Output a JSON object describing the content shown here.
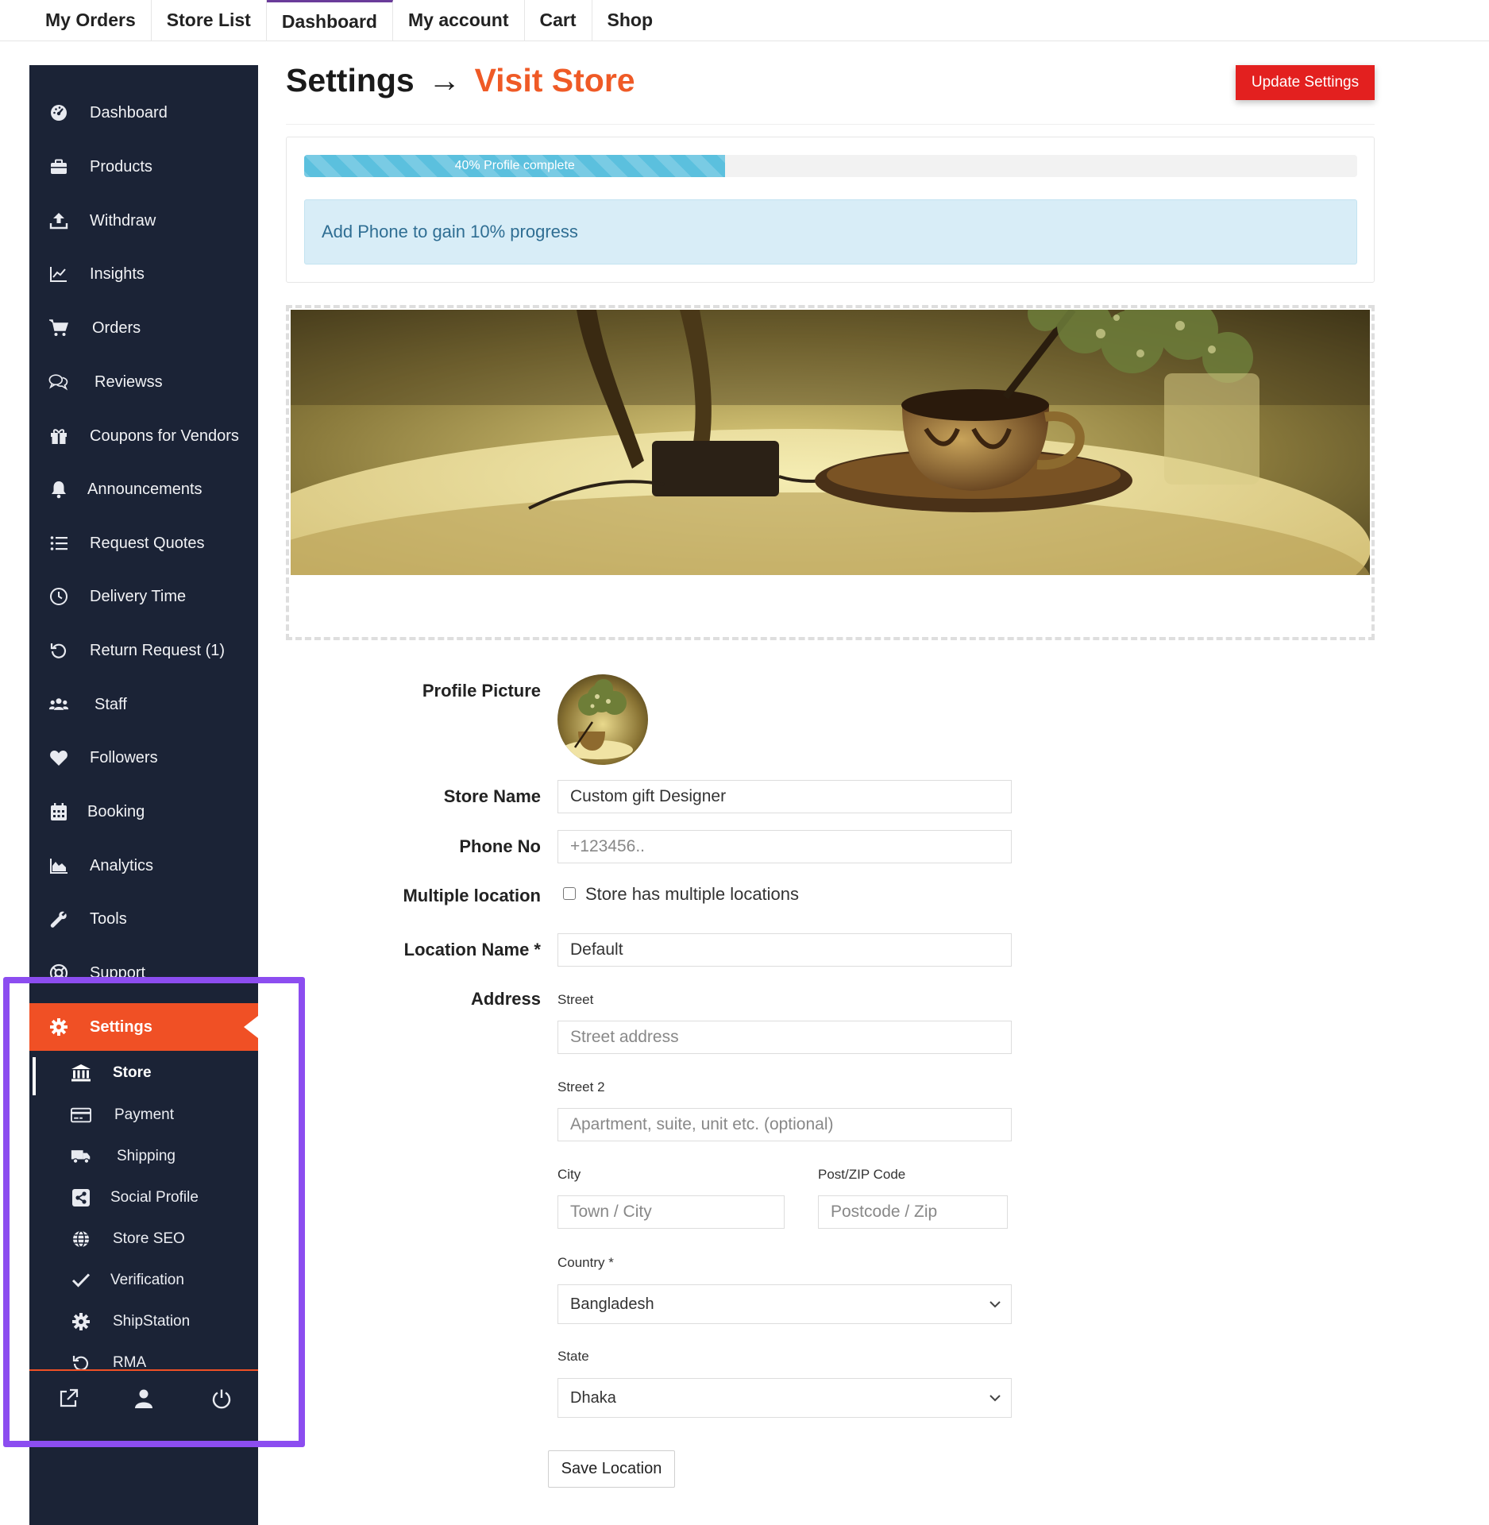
{
  "topnav": {
    "items": [
      {
        "label": "My Orders"
      },
      {
        "label": "Store List"
      },
      {
        "label": "Dashboard"
      },
      {
        "label": "My account"
      },
      {
        "label": "Cart"
      },
      {
        "label": "Shop"
      }
    ],
    "active": "Dashboard"
  },
  "sidebar": {
    "items": [
      {
        "label": "Dashboard",
        "icon": "dashboard-gauge-icon"
      },
      {
        "label": "Products",
        "icon": "briefcase-icon"
      },
      {
        "label": "Withdraw",
        "icon": "upload-icon"
      },
      {
        "label": "Insights",
        "icon": "line-chart-icon"
      },
      {
        "label": "Orders",
        "icon": "cart-icon"
      },
      {
        "label": "Reviewss",
        "icon": "comments-icon"
      },
      {
        "label": "Coupons for Vendors",
        "icon": "gift-icon"
      },
      {
        "label": "Announcements",
        "icon": "bell-icon"
      },
      {
        "label": "Request Quotes",
        "icon": "list-icon"
      },
      {
        "label": "Delivery Time",
        "icon": "clock-icon"
      },
      {
        "label": "Return Request (1)",
        "icon": "undo-icon"
      },
      {
        "label": "Staff",
        "icon": "users-icon"
      },
      {
        "label": "Followers",
        "icon": "heart-icon"
      },
      {
        "label": "Booking",
        "icon": "calendar-icon"
      },
      {
        "label": "Analytics",
        "icon": "area-chart-icon"
      },
      {
        "label": "Tools",
        "icon": "wrench-icon"
      },
      {
        "label": "Support",
        "icon": "life-ring-icon"
      },
      {
        "label": "Settings",
        "icon": "gear-icon",
        "active": true
      }
    ],
    "subitems": [
      {
        "label": "Store",
        "icon": "bank-icon",
        "active": true
      },
      {
        "label": "Payment",
        "icon": "credit-card-icon"
      },
      {
        "label": "Shipping",
        "icon": "truck-icon"
      },
      {
        "label": "Social Profile",
        "icon": "share-icon"
      },
      {
        "label": "Store SEO",
        "icon": "globe-icon"
      },
      {
        "label": "Verification",
        "icon": "check-icon"
      },
      {
        "label": "ShipStation",
        "icon": "gear-icon"
      },
      {
        "label": "RMA",
        "icon": "undo-icon"
      }
    ],
    "footer_icons": [
      "external-link-icon",
      "user-icon",
      "power-icon"
    ]
  },
  "header": {
    "title": "Settings",
    "arrow": "→",
    "link_label": "Visit Store",
    "update_label": "Update Settings"
  },
  "progress": {
    "percent": 40,
    "label": "40% Profile complete",
    "hint": "Add Phone to gain 10% progress"
  },
  "form": {
    "profile_picture_label": "Profile Picture",
    "store_name_label": "Store Name",
    "store_name_value": "Custom gift Designer",
    "phone_label": "Phone No",
    "phone_placeholder": "+123456..",
    "multiple_location_label": "Multiple location",
    "multiple_location_checkbox": "Store has multiple locations",
    "multiple_location_checked": false,
    "location_name_label": "Location Name *",
    "location_name_value": "Default",
    "address_label": "Address",
    "street_label": "Street",
    "street_placeholder": "Street address",
    "street2_label": "Street 2",
    "street2_placeholder": "Apartment, suite, unit etc. (optional)",
    "city_label": "City",
    "city_placeholder": "Town / City",
    "zip_label": "Post/ZIP Code",
    "zip_placeholder": "Postcode / Zip",
    "country_label": "Country *",
    "country_value": "Bangladesh",
    "state_label": "State",
    "state_value": "Dhaka",
    "save_location_label": "Save Location"
  },
  "colors": {
    "sidebar_bg": "#1b2336",
    "accent": "#f05025",
    "visit_store": "#ef5a26",
    "update_btn": "#e3201f",
    "progress": "#5bc0de",
    "hint_bg": "#d8edf7",
    "highlight": "#8c4df0"
  }
}
